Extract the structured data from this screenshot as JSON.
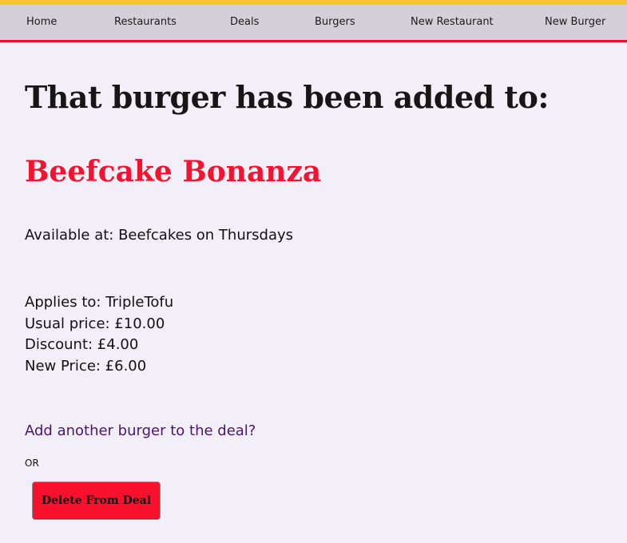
{
  "nav": {
    "items": [
      {
        "label": "Home"
      },
      {
        "label": "Restaurants"
      },
      {
        "label": "Deals"
      },
      {
        "label": "Burgers"
      },
      {
        "label": "New Restaurant"
      },
      {
        "label": "New Burger"
      }
    ]
  },
  "main": {
    "headline": "That burger has been added to:",
    "deal_name": "Beefcake Bonanza",
    "availability": "Available at: Beefcakes on Thursdays",
    "details": {
      "applies_to": "Applies to: TripleTofu",
      "usual_price": "Usual price: £10.00",
      "discount": "Discount: £4.00",
      "new_price": "New Price: £6.00"
    },
    "add_link": "Add another burger to the deal?",
    "or_text": "OR",
    "delete_button": "Delete From Deal"
  },
  "colors": {
    "top_stripe": "#f7c531",
    "nav_background": "#d4d0da",
    "nav_border": "#e3132b",
    "page_background": "#f2eff9",
    "deal_name": "#f5122f",
    "link": "#4a1470",
    "delete_button": "#f7112c"
  }
}
